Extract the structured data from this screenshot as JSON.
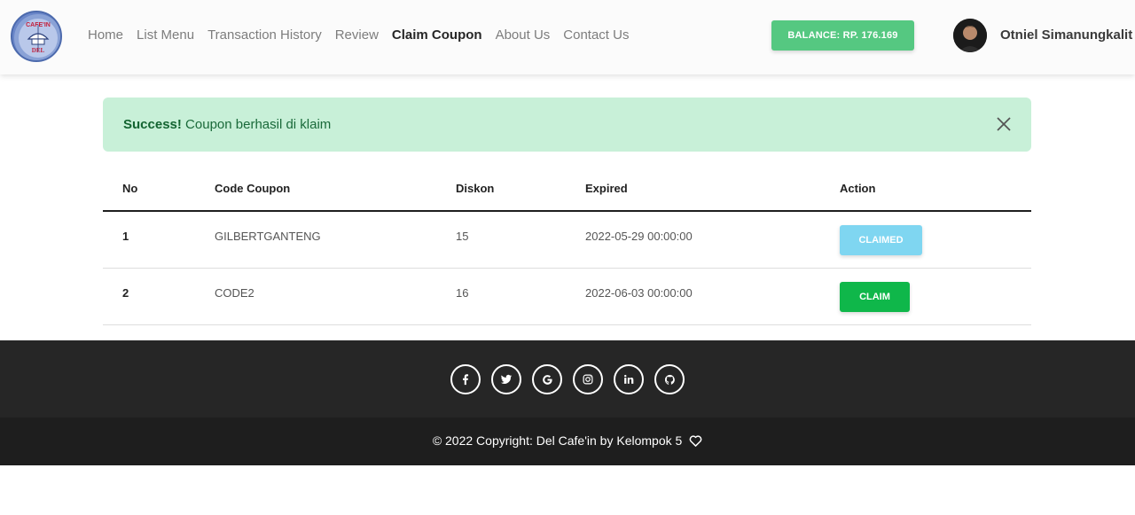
{
  "brand": {
    "logo_alt": "Cafe'in Del",
    "logo_top_text": "CAFE'IN",
    "logo_bottom_text": "DEL"
  },
  "nav": {
    "items": [
      {
        "label": "Home"
      },
      {
        "label": "List Menu"
      },
      {
        "label": "Transaction History"
      },
      {
        "label": "Review"
      },
      {
        "label": "Claim Coupon",
        "active": true
      },
      {
        "label": "About Us"
      },
      {
        "label": "Contact Us"
      }
    ],
    "balance_label": "BALANCE: RP. 176.169",
    "user_name": "Otniel Simanungkalit"
  },
  "alert": {
    "strong": "Success!",
    "message": "Coupon berhasil di klaim"
  },
  "table": {
    "headers": [
      "No",
      "Code Coupon",
      "Diskon",
      "Expired",
      "Action"
    ],
    "rows": [
      {
        "no": "1",
        "code": "GILBERTGANTENG",
        "diskon": "15",
        "expired": "2022-05-29 00:00:00",
        "action": "CLAIMED"
      },
      {
        "no": "2",
        "code": "CODE2",
        "diskon": "16",
        "expired": "2022-06-03 00:00:00",
        "action": "CLAIM"
      }
    ]
  },
  "footer": {
    "socials": [
      {
        "icon": "facebook-icon",
        "glyph": "f"
      },
      {
        "icon": "twitter-icon",
        "glyph": "t"
      },
      {
        "icon": "google-icon",
        "glyph": "G"
      },
      {
        "icon": "instagram-icon",
        "glyph": "◎"
      },
      {
        "icon": "linkedin-icon",
        "glyph": "in"
      },
      {
        "icon": "github-icon",
        "glyph": "gh"
      }
    ],
    "copyright": "© 2022 Copyright: Del Cafe'in by Kelompok 5"
  },
  "colors": {
    "balance": "#55c881",
    "alert_bg": "#c8f0d8",
    "claimed": "#7fd6f1",
    "claim": "#0fb74a",
    "footer": "#262626"
  }
}
